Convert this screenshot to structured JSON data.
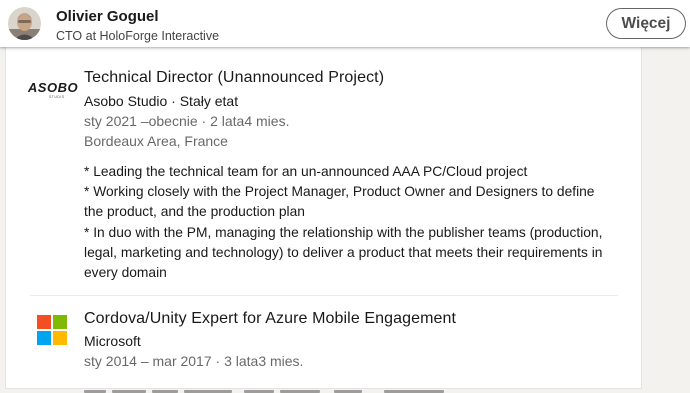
{
  "header": {
    "name": "Olivier Goguel",
    "headline": "CTO at HoloForge Interactive",
    "more_label": "Więcej",
    "avatar_icon": "profile-photo"
  },
  "experience": [
    {
      "logo_icon": "asobo-studio-logo",
      "logo_text": "ASOBO",
      "logo_subtext": "STUDIO",
      "title": "Technical Director (Unannounced Project)",
      "company": "Asobo Studio · Stały etat",
      "dates": "sty 2021 –obecnie · 2 lata4 mies.",
      "location": "Bordeaux Area, France",
      "description": [
        "* Leading the technical team for an un-announced AAA PC/Cloud project",
        "* Working closely with the Project Manager, Product Owner and Designers to define",
        "the product, and the production plan",
        "* In duo with the PM, managing the relationship with the publisher teams (production,",
        "legal, marketing and technology) to deliver a product that meets their requirements in",
        "every domain"
      ]
    },
    {
      "logo_icon": "microsoft-logo",
      "title": "Cordova/Unity Expert for Azure Mobile Engagement",
      "company": "Microsoft",
      "dates": "sty 2014 – mar 2017 · 3 lata3 mies."
    }
  ],
  "colors": {
    "background": "#f3f2ef",
    "card": "#ffffff",
    "ms_red": "#f25022",
    "ms_green": "#7fba00",
    "ms_blue": "#00a4ef",
    "ms_yellow": "#ffb900"
  }
}
